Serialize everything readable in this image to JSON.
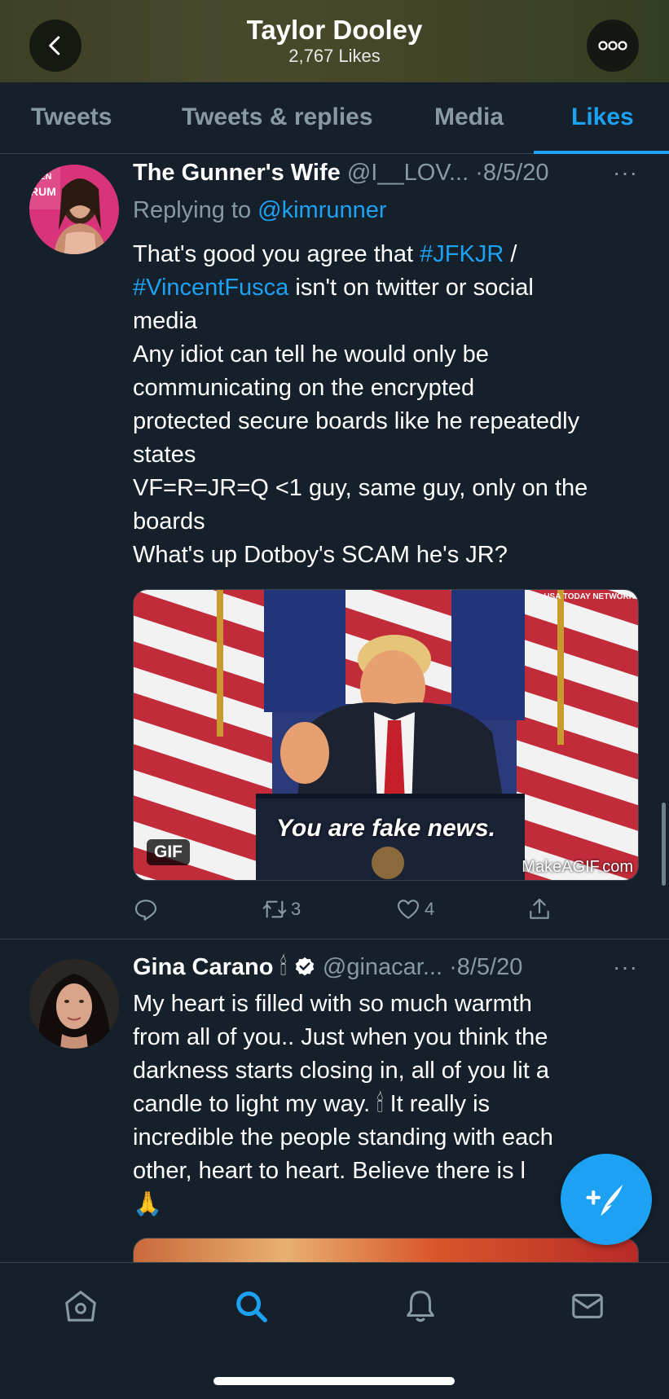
{
  "header": {
    "title": "Taylor Dooley",
    "subtitle": "2,767 Likes"
  },
  "tabs": [
    {
      "label": "Tweets"
    },
    {
      "label": "Tweets & replies"
    },
    {
      "label": "Media"
    },
    {
      "label": "Likes",
      "active": true
    }
  ],
  "tweets": [
    {
      "name": "The Gunner's Wife",
      "handle": "@I__LOV...",
      "date": "·8/5/20",
      "replying_prefix": "Replying to ",
      "replying_to": "@kimrunner",
      "body": {
        "l1_pre": "That's good you agree that ",
        "l1_tag": "#JFKJR",
        "l1_post": " /",
        "l2_tag": "#VincentFusca",
        "l2_post": " isn't on twitter or social",
        "l3": "media",
        "l4": "Any idiot can tell he would only be",
        "l5": "communicating on the encrypted",
        "l6": "protected secure boards like he repeatedly",
        "l7": "states",
        "l8": "VF=R=JR=Q <1 guy, same guy, only on the",
        "l9": "boards",
        "l10": "What's up Dotboy's SCAM he's JR?"
      },
      "media": {
        "caption": "You are fake news.",
        "badge": "GIF",
        "watermark": "MakeAGIF.com",
        "network": "USA TODAY NETWORK"
      },
      "retweets": "3",
      "likes": "4"
    },
    {
      "name": "Gina Carano",
      "name_emoji": "🕯",
      "handle": "@ginacar...",
      "date": "·8/5/20",
      "body": {
        "l1": "My heart is filled with so much warmth",
        "l2": "from all of you.. Just when you think the",
        "l3": "darkness starts closing in, all of you lit a",
        "l4_pre": "candle to light my way. ",
        "l4_emoji": "🕯",
        "l4_post": "  It really is",
        "l5": "incredible the people standing with each",
        "l6": "other, heart to heart. Believe there is l",
        "l7": "🙏"
      }
    }
  ],
  "more_glyph": "···",
  "colors": {
    "background": "#15202b",
    "accent": "#1da1f2",
    "muted": "#8899a6",
    "divider": "#38444d"
  },
  "bottom_nav": [
    {
      "icon": "home-icon"
    },
    {
      "icon": "search-icon",
      "active": true
    },
    {
      "icon": "bell-icon"
    },
    {
      "icon": "mail-icon"
    }
  ]
}
